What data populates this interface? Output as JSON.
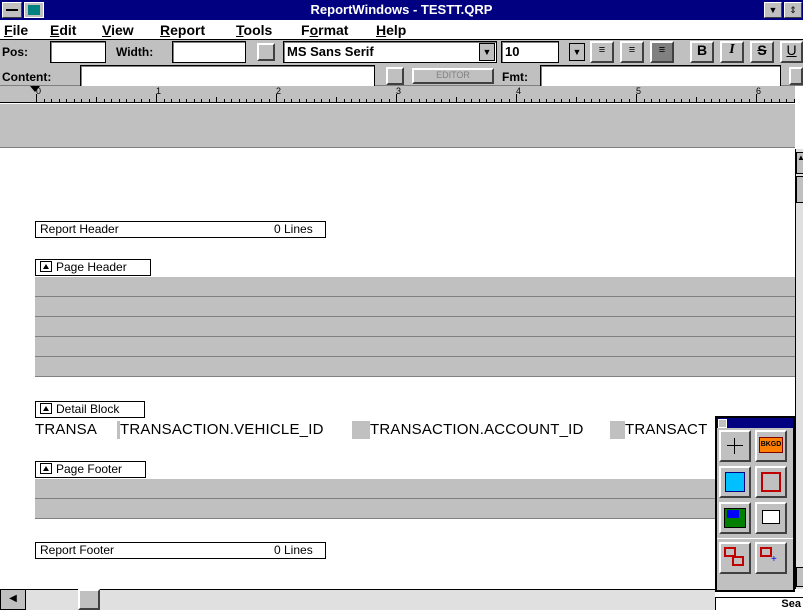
{
  "window": {
    "title": "ReportWindows - TESTT.QRP",
    "minimize_glyph": "▼",
    "maximize_glyph": "⇕"
  },
  "menu": [
    {
      "label": "File",
      "u": "F",
      "rest": "ile"
    },
    {
      "label": "Edit",
      "u": "E",
      "rest": "dit"
    },
    {
      "label": "View",
      "u": "V",
      "rest": "iew"
    },
    {
      "label": "Report",
      "u": "R",
      "rest": "eport"
    },
    {
      "label": "Tools",
      "u": "T",
      "rest": "ools"
    },
    {
      "label": "Format",
      "pre": "F",
      "u": "o",
      "rest": "rmat"
    },
    {
      "label": "Help",
      "u": "H",
      "rest": "elp"
    }
  ],
  "toolbar": {
    "pos_label": "Pos:",
    "pos_value": "",
    "width_label": "Width:",
    "width_value": "",
    "font_name": "MS Sans Serif",
    "font_size": "10",
    "bold_label": "B",
    "italic_label": "I",
    "strike_label": "S",
    "underline_label": "U",
    "content_label": "Content:",
    "content_value": "",
    "editor_label": "EDITOR",
    "fmt_label": "Fmt:",
    "fmt_value": ""
  },
  "ruler": {
    "marks": [
      "0",
      "1",
      "2",
      "3",
      "4",
      "5",
      "6"
    ]
  },
  "bands": {
    "report_header": {
      "label": "Report Header",
      "lines": "0 Lines"
    },
    "page_header": {
      "label": "Page Header"
    },
    "detail_block": {
      "label": "Detail Block"
    },
    "page_footer": {
      "label": "Page Footer"
    },
    "report_footer": {
      "label": "Report Footer",
      "lines": "0 Lines"
    }
  },
  "detail_fields": [
    "TRANSA",
    "TRANSACTION.VEHICLE_ID",
    "TRANSACTION.ACCOUNT_ID",
    "TRANSACT"
  ],
  "palette": {
    "tools": [
      "crosshair-tool",
      "field-tool",
      "bitmap-insert-tool",
      "box-tool",
      "picture-tool",
      "text-tool",
      "link-tool",
      "link-select-tool"
    ],
    "bkgd_label": "BKGD"
  },
  "status": {
    "text": "Sea"
  },
  "colors": {
    "titlebar": "#000080",
    "face": "#c0c0c0"
  }
}
